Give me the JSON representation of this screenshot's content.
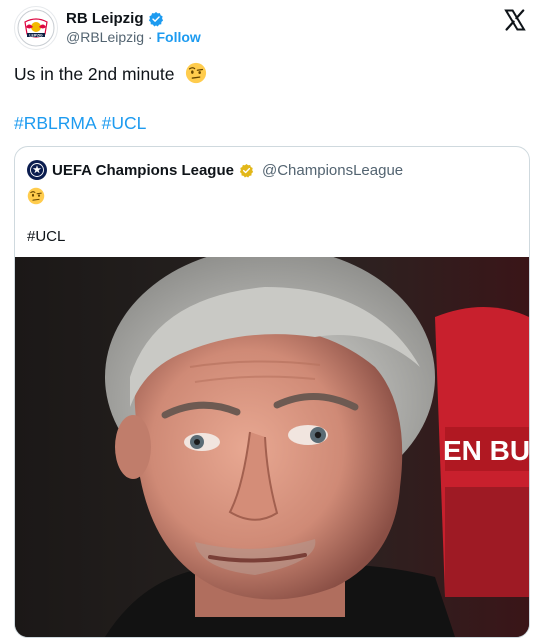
{
  "tweet": {
    "author_name": "RB Leipzig",
    "author_handle": "@RBLeipzig",
    "separator": "·",
    "follow_label": "Follow",
    "text": "Us in the 2nd minute",
    "emoji": "face-with-raised-eyebrow",
    "hashtags": [
      "#RBLRMA",
      "#UCL"
    ],
    "avatar_text": "LEIPZIG"
  },
  "quoted": {
    "author_name": "UEFA Champions League",
    "author_handle": "@ChampionsLeague",
    "emoji": "face-with-raised-eyebrow",
    "hashtag": "#UCL",
    "media_text": "EN BULL"
  },
  "colors": {
    "link": "#1d9bf0",
    "secondary_text": "#536471",
    "border": "#cfd9de",
    "verified_blue": "#1d9bf0",
    "verified_gold": "#e2b719",
    "rb_red": "#dd0741"
  }
}
